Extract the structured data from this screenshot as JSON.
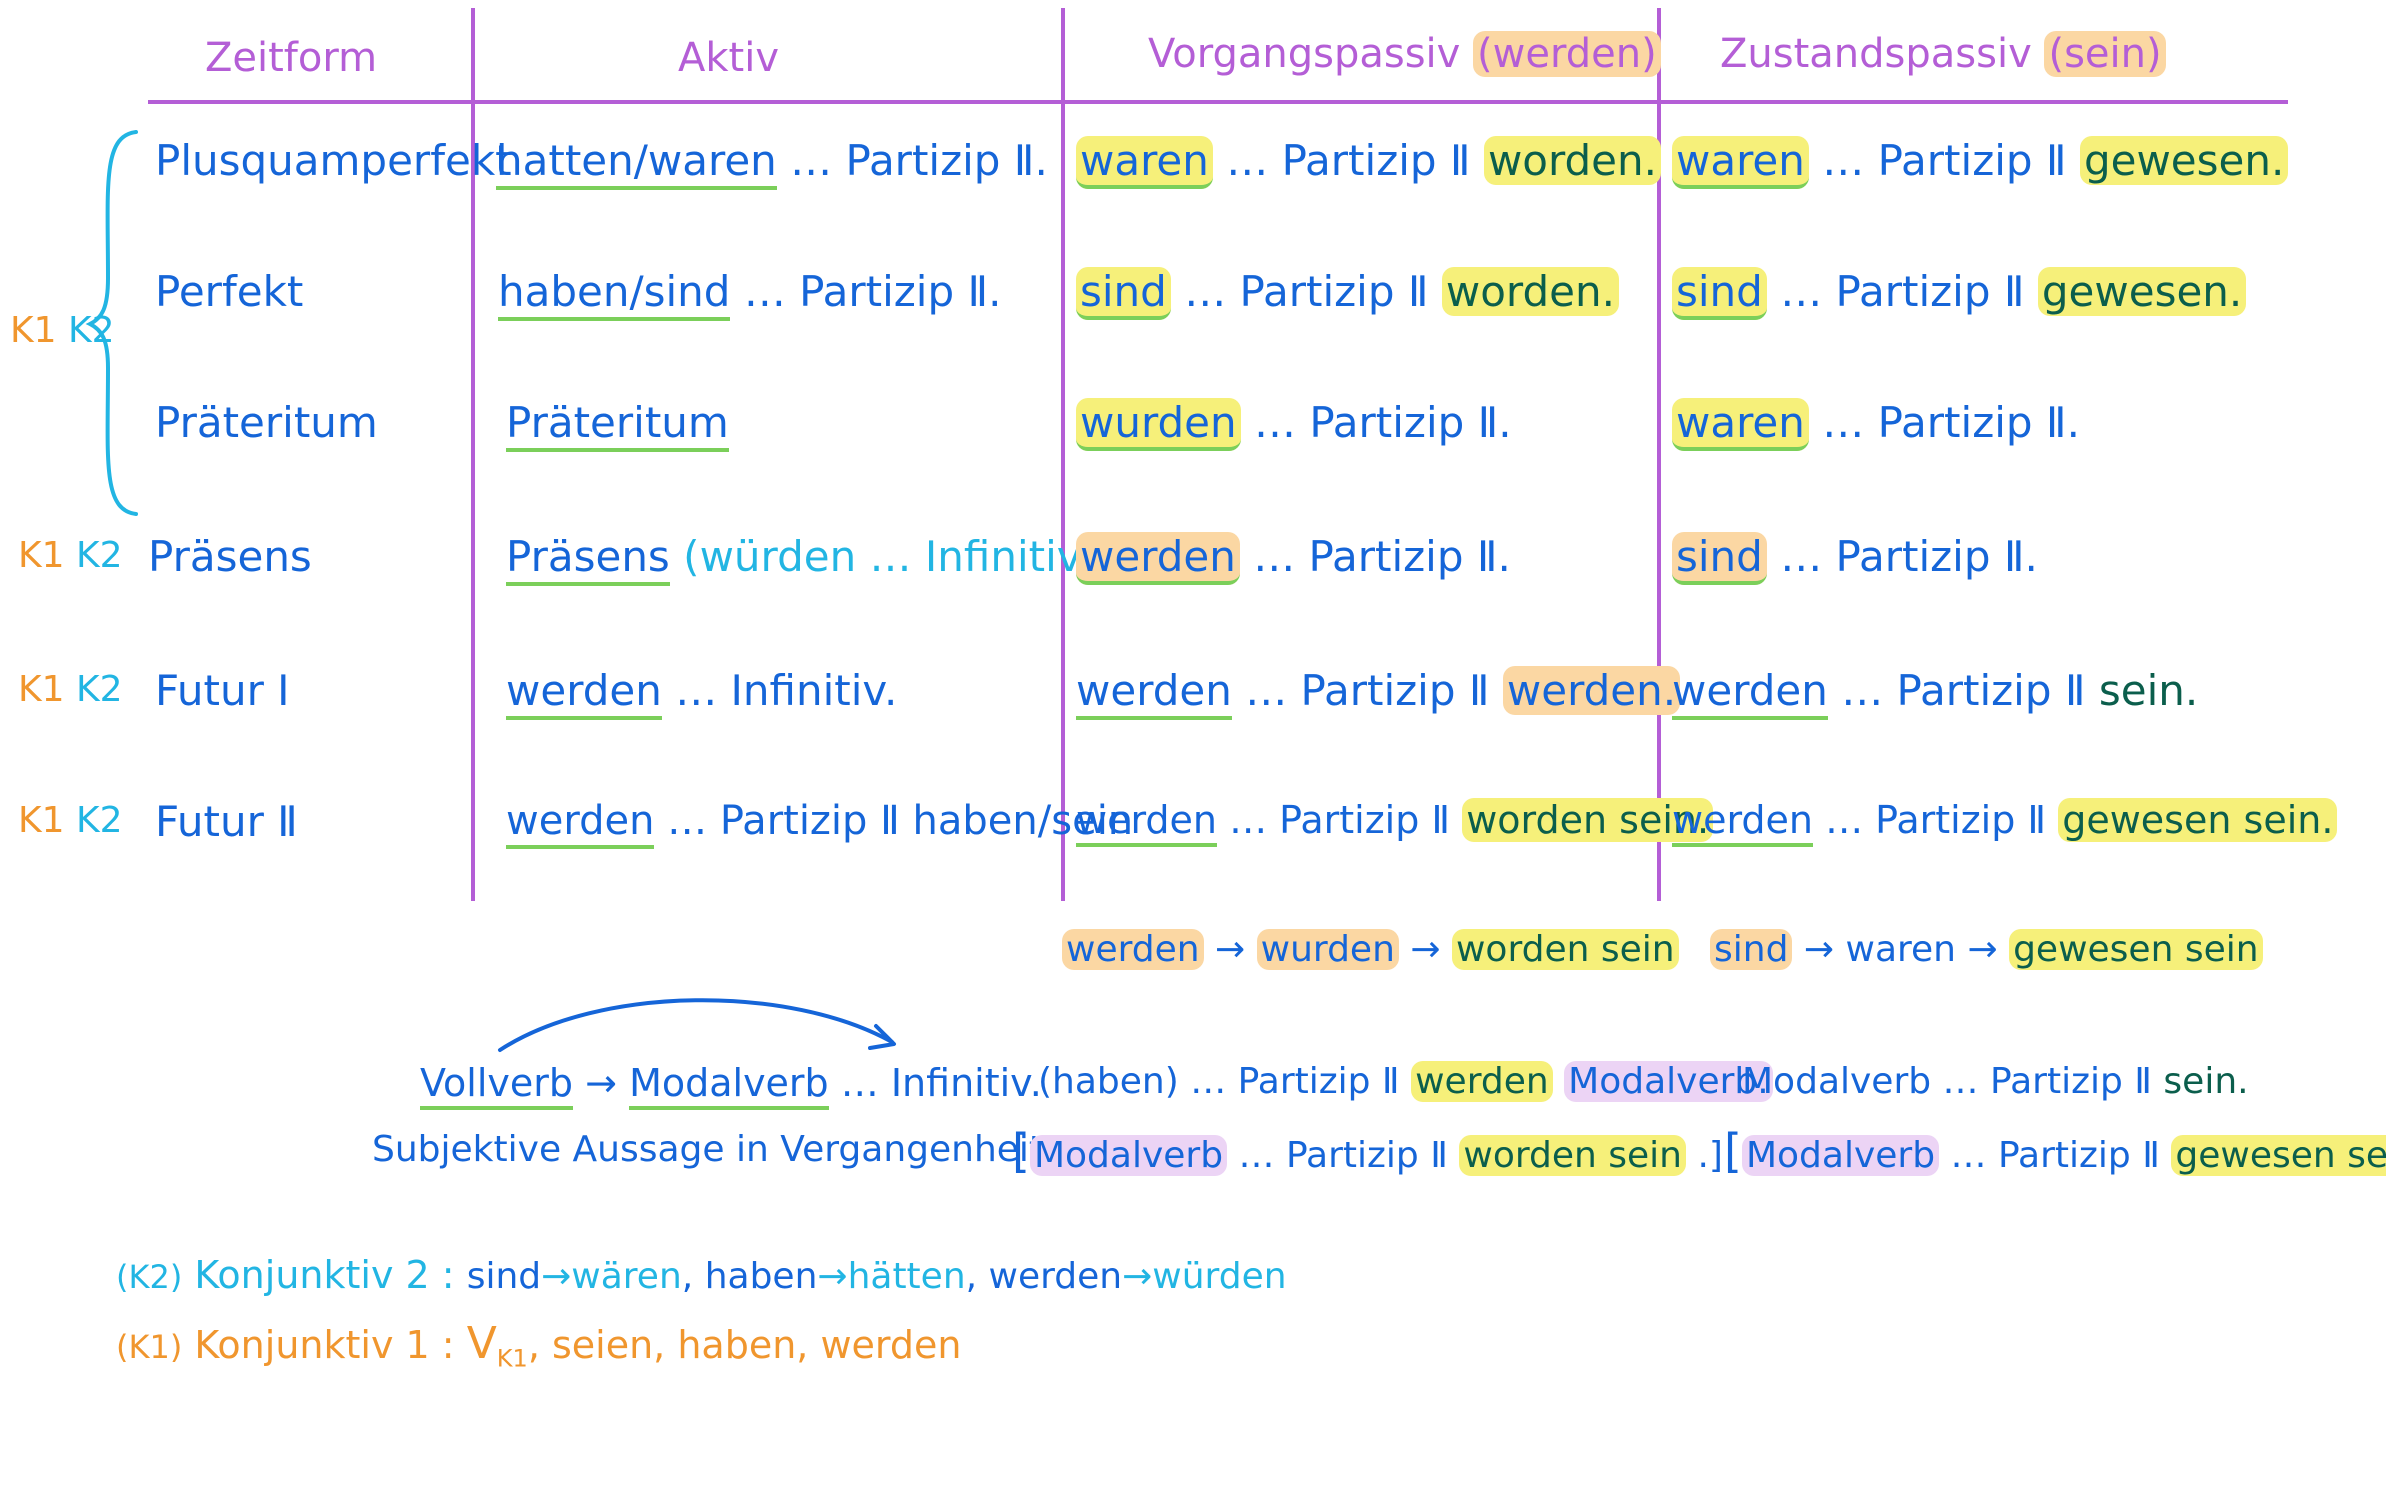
{
  "headers": {
    "zeitform": "Zeitform",
    "aktiv": "Aktiv",
    "vorgangspassiv": "Vorgangspassiv",
    "vorgangspassiv_aux": "(werden)",
    "zustandspassiv": "Zustandspassiv",
    "zustandspassiv_aux": "(sein)"
  },
  "group_label": {
    "k1": "K1",
    "k2": "K2"
  },
  "rows": [
    {
      "k1": "",
      "k2": "",
      "tense": "Plusquamperfekt",
      "aktiv": [
        "hatten/waren",
        " … Partizip Ⅱ."
      ],
      "vorgang": [
        "waren",
        " … Partizip Ⅱ ",
        "worden."
      ],
      "zustand": [
        "waren",
        " … Partizip Ⅱ ",
        "gewesen."
      ]
    },
    {
      "k1": "",
      "k2": "",
      "tense": "Perfekt",
      "aktiv": [
        "haben/sind",
        " … Partizip Ⅱ."
      ],
      "vorgang": [
        "sind",
        " … Partizip Ⅱ ",
        "worden."
      ],
      "zustand": [
        "sind",
        " … Partizip Ⅱ ",
        "gewesen."
      ]
    },
    {
      "k1": "",
      "k2": "",
      "tense": "Präteritum",
      "aktiv": [
        "Präteritum"
      ],
      "vorgang": [
        "wurden",
        " … Partizip Ⅱ."
      ],
      "zustand": [
        "waren",
        " … Partizip Ⅱ."
      ]
    },
    {
      "k1": "K1",
      "k2": "K2",
      "tense": "Präsens",
      "aktiv": [
        "Präsens",
        " (würden … Infinitiv.)"
      ],
      "vorgang": [
        "werden",
        " … Partizip Ⅱ."
      ],
      "zustand": [
        "sind",
        " … Partizip Ⅱ."
      ]
    },
    {
      "k1": "K1",
      "k2": "K2",
      "tense": "Futur I",
      "aktiv": [
        "werden",
        " … Infinitiv."
      ],
      "vorgang": [
        "werden",
        " … Partizip Ⅱ ",
        "werden."
      ],
      "zustand": [
        "werden",
        " … Partizip Ⅱ ",
        "sein."
      ]
    },
    {
      "k1": "K1",
      "k2": "K2",
      "tense": "Futur Ⅱ",
      "aktiv": [
        "werden",
        " … Partizip Ⅱ haben/sein"
      ],
      "vorgang": [
        "werden",
        " … Partizip Ⅱ ",
        "worden sein."
      ],
      "zustand": [
        "werden",
        " … Partizip Ⅱ ",
        "gewesen sein."
      ]
    }
  ],
  "chains": {
    "vorgang": [
      "werden",
      "→",
      "wurden",
      "→",
      "worden sein"
    ],
    "zustand": [
      "sind",
      "→",
      "waren",
      "→",
      "gewesen sein"
    ]
  },
  "modal": {
    "line1": {
      "vollverb": "Vollverb",
      "arrow": "→",
      "modalverb": "Modalverb",
      "rest": " … Infinitiv.",
      "vorgang": [
        "(haben) … Partizip Ⅱ ",
        "werden",
        " ",
        "Modalverb."
      ],
      "zustand": [
        "Modalverb",
        " … Partizip Ⅱ ",
        "sein."
      ]
    },
    "line2": {
      "label": "Subjektive Aussage in Vergangenheit",
      "vorgang": [
        "[",
        "Modalverb",
        " … Partizip Ⅱ ",
        "worden sein",
        " .]"
      ],
      "zustand": [
        "[",
        "Modalverb",
        " … Partizip Ⅱ ",
        "gewesen sein",
        ".]"
      ]
    }
  },
  "legend": {
    "k2": {
      "tag": "(K2)",
      "name": "Konjunktiv 2 :",
      "items": [
        "sind",
        "→",
        "wären",
        ",",
        "haben",
        "→",
        "hätten",
        ",",
        "werden",
        "→",
        "würden"
      ]
    },
    "k1": {
      "tag": "(K1)",
      "name": "Konjunktiv 1 :",
      "v": "V",
      "vsub": "K1",
      "rest": ", seien, haben, werden"
    }
  },
  "colors": {
    "header": "#b45ed6",
    "text": "#1565d8",
    "k2": "#22b5e3",
    "k1": "#f0962e",
    "underline": "#7bcf5a",
    "highlight_yellow": "#f6f07a",
    "highlight_orange": "#fbd7a3"
  }
}
